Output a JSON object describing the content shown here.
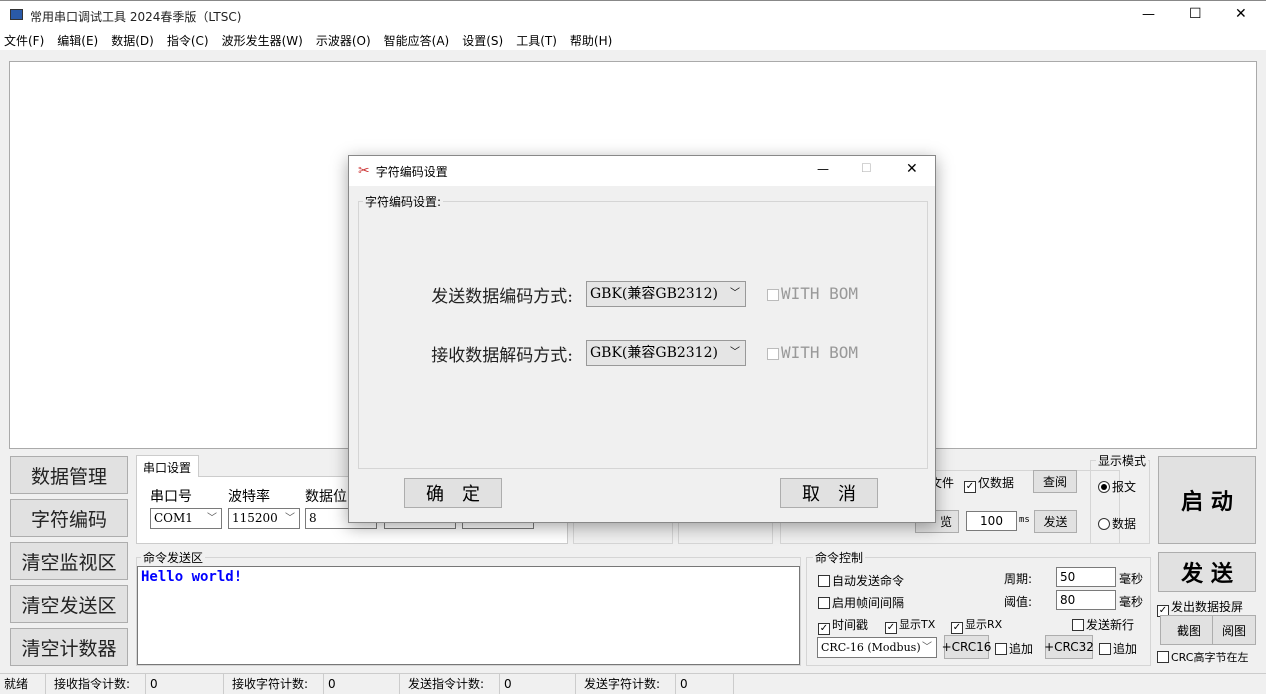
{
  "window": {
    "title": "常用串口调试工具 2024春季版（LTSC)",
    "min": "—",
    "max": "☐",
    "close": "✕"
  },
  "menu": [
    "文件(F)",
    "编辑(E)",
    "数据(D)",
    "指令(C)",
    "波形发生器(W)",
    "示波器(O)",
    "智能应答(A)",
    "设置(S)",
    "工具(T)",
    "帮助(H)"
  ],
  "left_buttons": [
    "数据管理",
    "字符编码",
    "清空监视区",
    "清空发送区",
    "清空计数器"
  ],
  "port": {
    "tab": "串口设置",
    "labels": [
      "串口号",
      "波特率",
      "数据位"
    ],
    "port_value": "COM1",
    "baud_value": "115200",
    "databits_value": "8"
  },
  "file": {
    "file_label": "文件",
    "only_data": "仅数据",
    "view_btn": "查阅",
    "browse_btn": "览",
    "interval": "100",
    "ms": "ms",
    "send_btn": "发送"
  },
  "display_mode": {
    "title": "显示模式",
    "options": [
      "报文",
      "数据"
    ]
  },
  "start_btn": "启 动",
  "send_big_btn": "发 送",
  "mirror": "发出数据投屏",
  "screenshot_btn": "截图",
  "viewimg_btn": "阅图",
  "crc_high_left": "CRC高字节在左",
  "cmd_send": {
    "title": "命令发送区",
    "text": "Hello world!"
  },
  "cmd_ctrl": {
    "title": "命令控制",
    "auto_send": "自动发送命令",
    "frame_gap": "启用帧间间隔",
    "period_label": "周期:",
    "period": "50",
    "threshold_label": "阈值:",
    "threshold": "80",
    "unit": "毫秒",
    "timestamp": "时间戳",
    "show_tx": "显示TX",
    "show_rx": "显示RX",
    "send_newline": "发送新行",
    "crc_type": "CRC-16 (Modbus)",
    "crc16_btn": "+CRC16",
    "crc32_btn": "+CRC32",
    "append": "追加"
  },
  "status": {
    "ready": "就绪",
    "items": [
      {
        "label": "接收指令计数:",
        "value": "0"
      },
      {
        "label": "接收字符计数:",
        "value": "0"
      },
      {
        "label": "发送指令计数:",
        "value": "0"
      },
      {
        "label": "发送字符计数:",
        "value": "0"
      }
    ]
  },
  "dialog": {
    "title": "字符编码设置",
    "group": "字符编码设置:",
    "send_label": "发送数据编码方式:",
    "recv_label": "接收数据解码方式:",
    "send_enc": "GBK(兼容GB2312)",
    "recv_enc": "GBK(兼容GB2312)",
    "bom": "WITH BOM",
    "ok": "确定",
    "cancel": "取消"
  }
}
